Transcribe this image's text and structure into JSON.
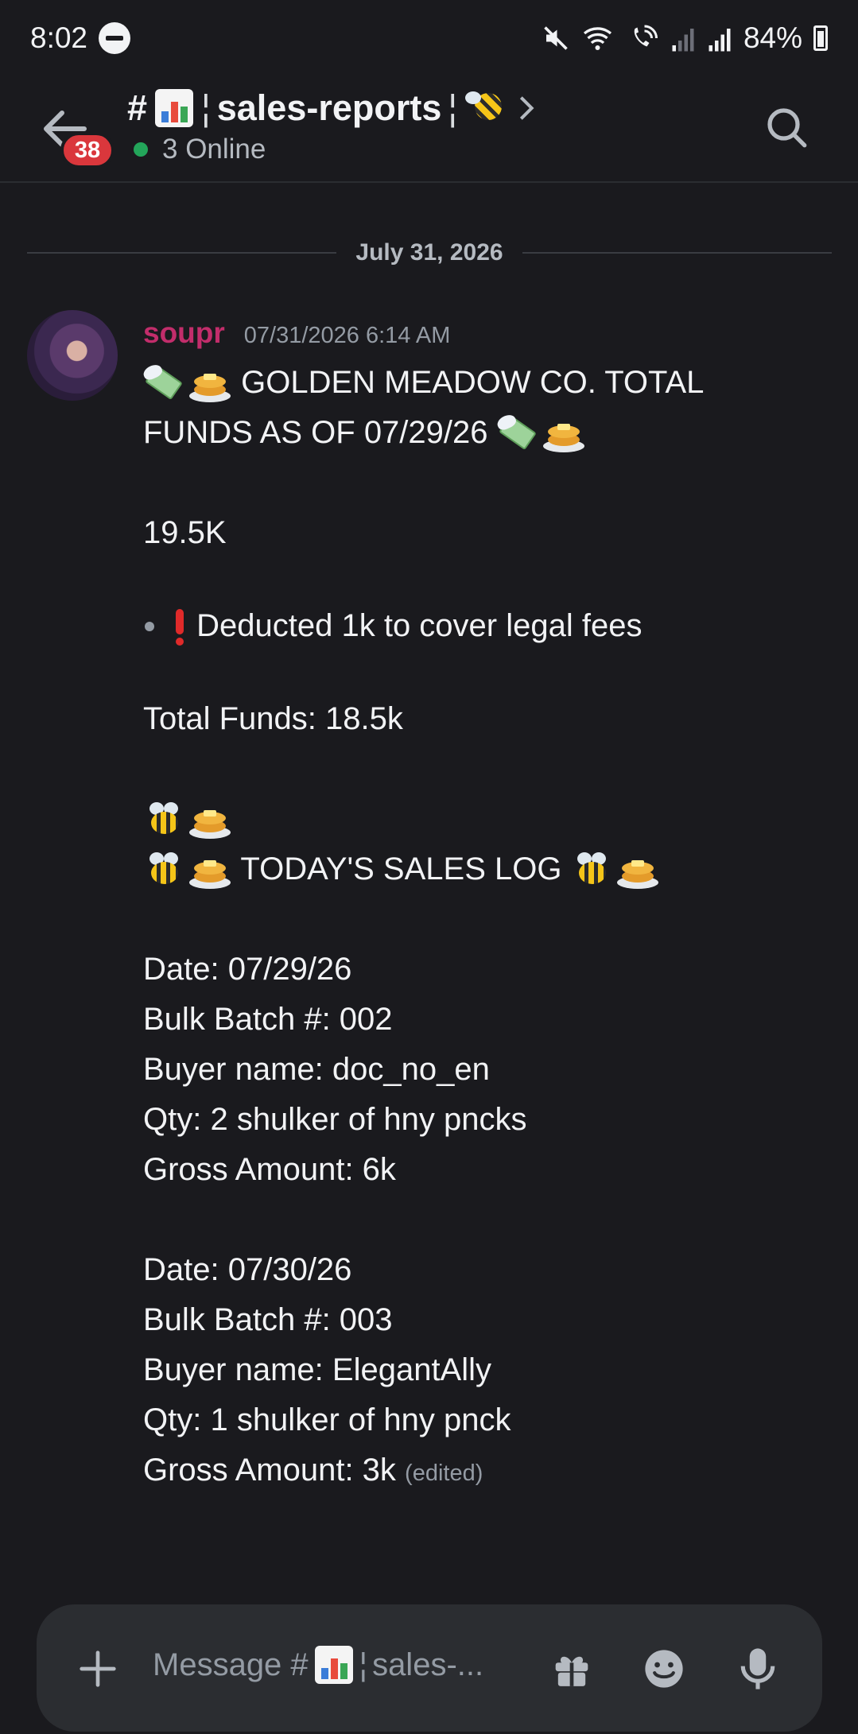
{
  "status_bar": {
    "time": "8:02",
    "battery": "84%"
  },
  "header": {
    "unread_badge": "38",
    "channel_name": "sales-reports",
    "online_status": "3 Online"
  },
  "date_divider": "July 31, 2026",
  "message": {
    "author": "soupr",
    "author_color": "#c22d6b",
    "timestamp": "07/31/2026 6:14 AM",
    "title_line1": "GOLDEN MEADOW CO. TOTAL",
    "title_line2": "FUNDS AS OF 07/29/26",
    "amount": "19.5K",
    "bullet": "Deducted 1k to cover legal fees",
    "total_funds": "Total Funds: 18.5k",
    "sales_log_title": "TODAY'S SALES LOG",
    "entries": [
      {
        "date": "Date: 07/29/26",
        "batch": "Bulk Batch #: 002",
        "buyer": "Buyer name: doc_no_en",
        "qty": "Qty: 2 shulker of hny pncks",
        "gross": "Gross Amount: 6k"
      },
      {
        "date": "Date: 07/30/26",
        "batch": "Bulk Batch #: 003",
        "buyer": "Buyer name: ElegantAlly",
        "qty": "Qty: 1 shulker of hny pnck",
        "gross": "Gross Amount: 3k"
      }
    ],
    "edited_label": "(edited)"
  },
  "composer": {
    "placeholder": "Message #",
    "placeholder_channel": "sales-..."
  },
  "icons": [
    "back-arrow-icon",
    "search-icon",
    "plus-icon",
    "gift-icon",
    "emoji-icon",
    "mic-icon",
    "mute-icon",
    "wifi-icon",
    "signal-icon",
    "battery-icon",
    "dnd-icon"
  ]
}
